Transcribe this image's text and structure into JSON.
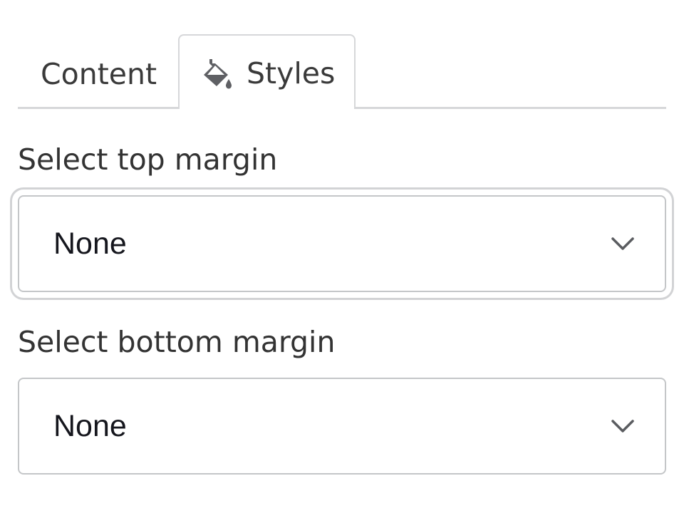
{
  "tabs": [
    {
      "label": "Content",
      "active": false
    },
    {
      "label": "Styles",
      "active": true,
      "icon": "paint-bucket-icon"
    }
  ],
  "fields": {
    "top_margin": {
      "label": "Select top margin",
      "value": "None",
      "focused": true
    },
    "bottom_margin": {
      "label": "Select bottom margin",
      "value": "None",
      "focused": false
    }
  },
  "colors": {
    "text": "#333333",
    "value_text": "#15161d",
    "border": "#c4c6c8",
    "focus_ring": "#d2d3d5",
    "chevron": "#5a5c60"
  }
}
